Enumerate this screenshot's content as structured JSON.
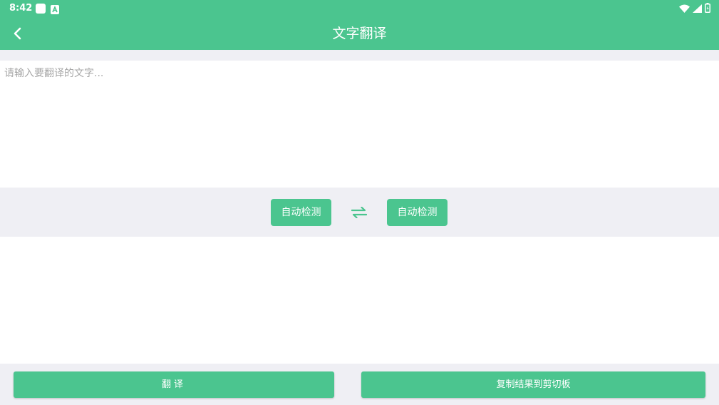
{
  "colors": {
    "accent": "#4bc58f",
    "background": "#efeff4",
    "surface": "#ffffff",
    "placeholder": "#a7a7a7"
  },
  "status_bar": {
    "time": "8:42",
    "notification_icons": [
      "square-notification-icon",
      "app-notification-icon"
    ],
    "system_icons": [
      "wifi-icon",
      "cellular-signal-icon",
      "battery-icon"
    ]
  },
  "toolbar": {
    "back_icon": "chevron-left-icon",
    "title": "文字翻译"
  },
  "source": {
    "value": "",
    "placeholder": "请输入要翻译的文字..."
  },
  "languages": {
    "from_label": "自动检测",
    "swap_icon": "swap-arrows-icon",
    "to_label": "自动检测"
  },
  "result": {
    "text": ""
  },
  "actions": {
    "translate_label": "翻译",
    "copy_label": "复制结果到剪切板"
  }
}
